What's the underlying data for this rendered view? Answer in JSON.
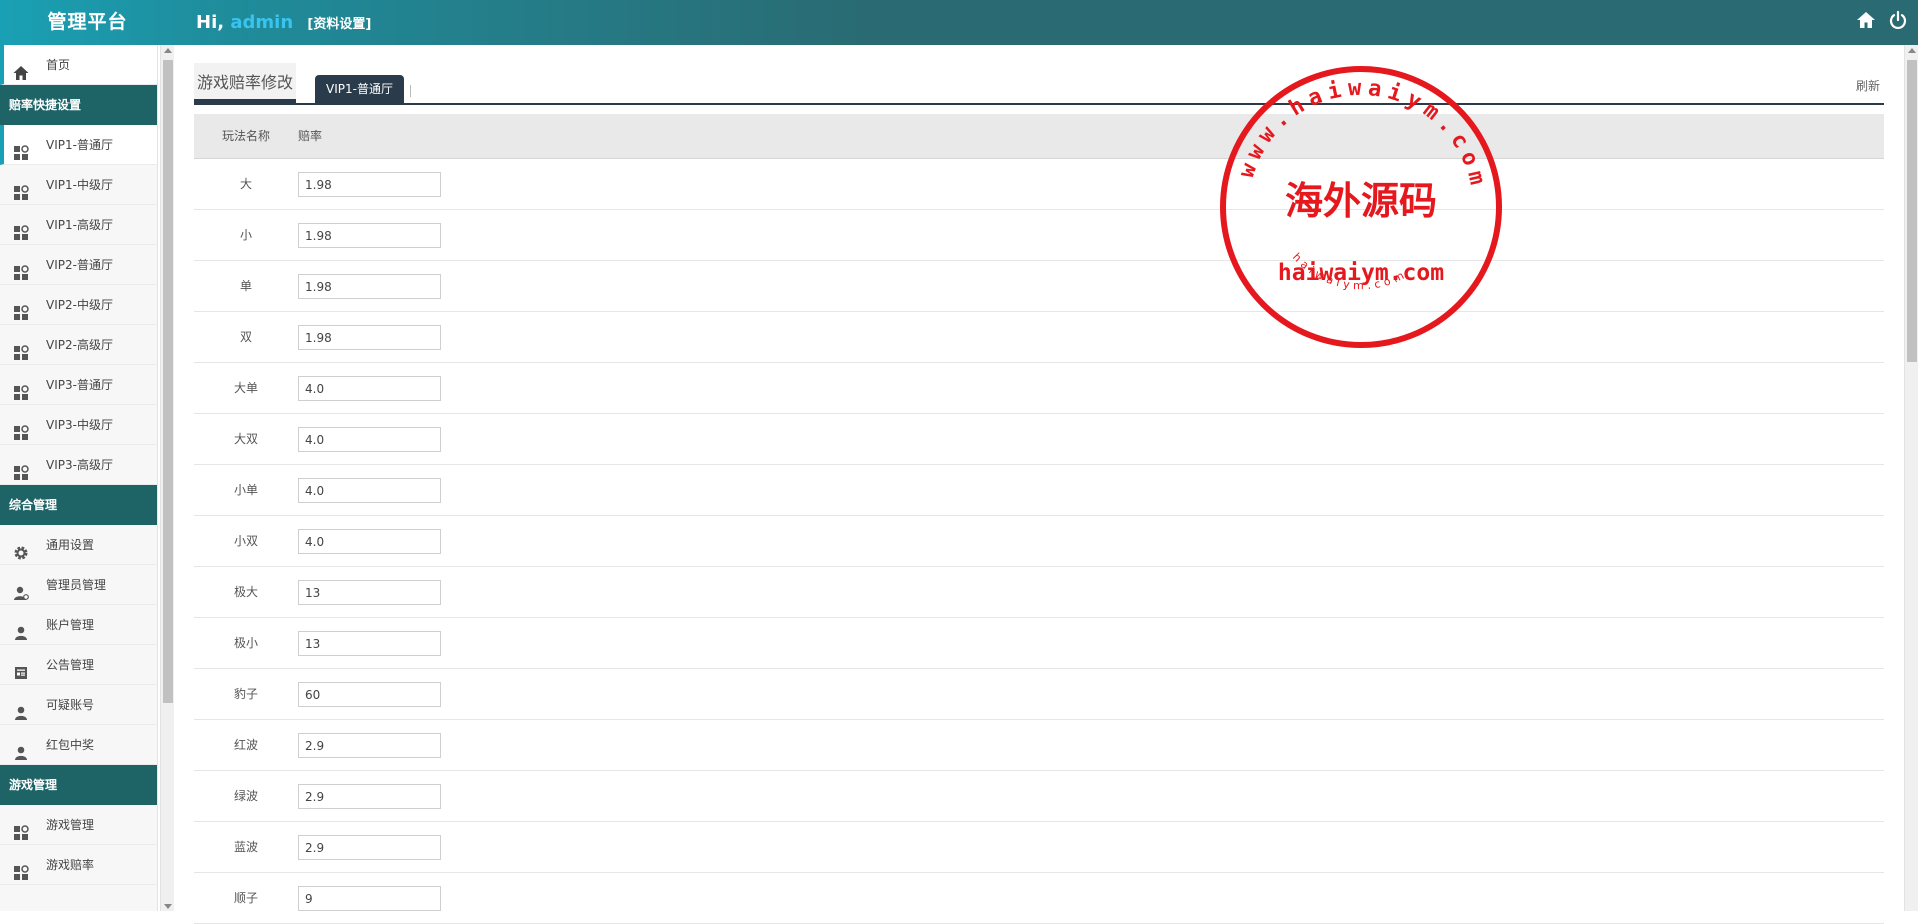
{
  "header": {
    "brand": "管理平台",
    "hi": "Hi,",
    "username": "admin",
    "profile_link": "[资料设置]"
  },
  "sidebar": {
    "home": "首页",
    "sections": [
      {
        "title": "赔率快捷设置",
        "items": [
          "VIP1-普通厅",
          "VIP1-中级厅",
          "VIP1-高级厅",
          "VIP2-普通厅",
          "VIP2-中级厅",
          "VIP2-高级厅",
          "VIP3-普通厅",
          "VIP3-中级厅",
          "VIP3-高级厅"
        ]
      },
      {
        "title": "综合管理",
        "items": [
          "通用设置",
          "管理员管理",
          "账户管理",
          "公告管理",
          "可疑账号",
          "红包中奖"
        ]
      },
      {
        "title": "游戏管理",
        "items": [
          "游戏管理",
          "游戏赔率"
        ]
      }
    ]
  },
  "tabs": {
    "main": "游戏赔率修改",
    "current": "VIP1-普通厅",
    "refresh": "刷新"
  },
  "table": {
    "col_name": "玩法名称",
    "col_odds": "赔率",
    "rows": [
      {
        "name": "大",
        "value": "1.98"
      },
      {
        "name": "小",
        "value": "1.98"
      },
      {
        "name": "单",
        "value": "1.98"
      },
      {
        "name": "双",
        "value": "1.98"
      },
      {
        "name": "大单",
        "value": "4.0"
      },
      {
        "name": "大双",
        "value": "4.0"
      },
      {
        "name": "小单",
        "value": "4.0"
      },
      {
        "name": "小双",
        "value": "4.0"
      },
      {
        "name": "极大",
        "value": "13"
      },
      {
        "name": "极小",
        "value": "13"
      },
      {
        "name": "豹子",
        "value": "60"
      },
      {
        "name": "红波",
        "value": "2.9"
      },
      {
        "name": "绿波",
        "value": "2.9"
      },
      {
        "name": "蓝波",
        "value": "2.9"
      },
      {
        "name": "顺子",
        "value": "9"
      }
    ]
  },
  "watermark": {
    "ring_text": "www.haiwaiym.com",
    "center_text": "海外源码",
    "domain_text": "haiwaiym.com",
    "small_text": "haiwaiym.com"
  },
  "colors": {
    "header_start": "#1aa0b4",
    "header_end": "#2a6b73",
    "section_head": "#1e6467",
    "tab_dark": "#2a3b4b",
    "username": "#39c3ee",
    "stamp_red": "#e5181e"
  }
}
